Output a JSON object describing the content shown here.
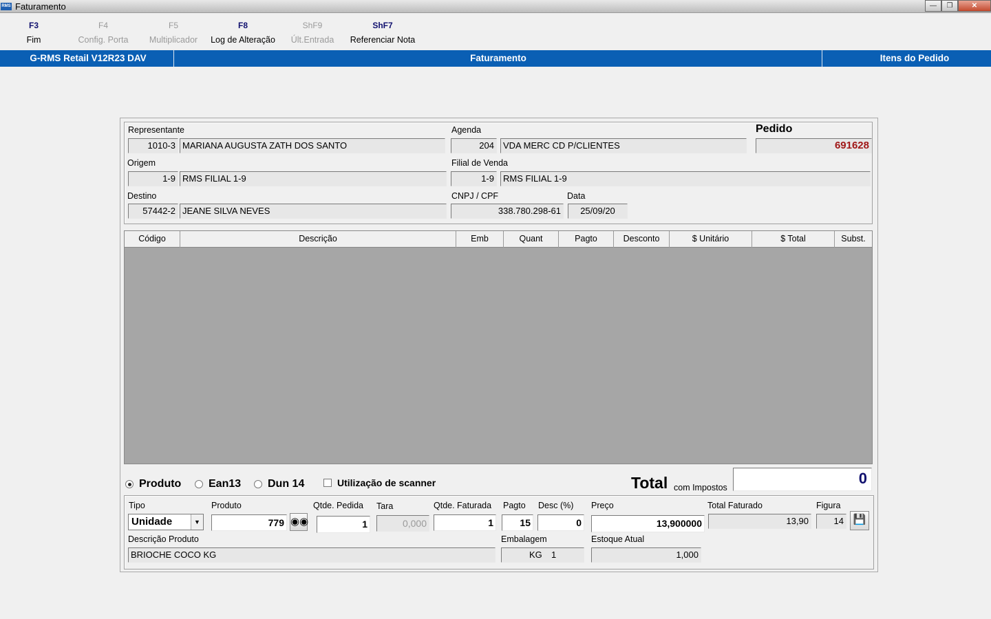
{
  "window": {
    "title": "Faturamento",
    "app_icon_text": "RMS"
  },
  "fkeys": [
    {
      "key": "F3",
      "label": "Fim",
      "enabled": true
    },
    {
      "key": "F4",
      "label": "Config. Porta",
      "enabled": false
    },
    {
      "key": "F5",
      "label": "Multiplicador",
      "enabled": false
    },
    {
      "key": "F8",
      "label": "Log de Alteração",
      "enabled": true
    },
    {
      "key": "ShF9",
      "label": "Últ.Entrada",
      "enabled": false
    },
    {
      "key": "ShF7",
      "label": "Referenciar Nota",
      "enabled": true
    }
  ],
  "band": {
    "system": "G-RMS Retail V12R23 DAV",
    "screen": "Faturamento",
    "section": "Itens do Pedido"
  },
  "header": {
    "representante": {
      "label": "Representante",
      "code": "1010-3",
      "name": "MARIANA AUGUSTA ZATH DOS SANTO"
    },
    "agenda": {
      "label": "Agenda",
      "code": "204",
      "name": "VDA MERC CD P/CLIENTES"
    },
    "pedido": {
      "label": "Pedido",
      "value": "691628"
    },
    "origem": {
      "label": "Origem",
      "code": "1-9",
      "name": "RMS FILIAL 1-9"
    },
    "filial": {
      "label": "Filial de Venda",
      "code": "1-9",
      "name": "RMS FILIAL 1-9"
    },
    "destino": {
      "label": "Destino",
      "code": "57442-2",
      "name": "JEANE SILVA NEVES"
    },
    "cnpj": {
      "label": "CNPJ / CPF",
      "value": "338.780.298-61"
    },
    "data": {
      "label": "Data",
      "value": "25/09/20"
    }
  },
  "grid": {
    "columns": [
      "Código",
      "Descrição",
      "Emb",
      "Quant",
      "Pagto",
      "Desconto",
      "$ Unitário",
      "$ Total",
      "Subst."
    ]
  },
  "mode": {
    "options": [
      "Produto",
      "Ean13",
      "Dun 14"
    ],
    "selected": "Produto",
    "scanner_label": "Utilização de scanner"
  },
  "total": {
    "title": "Total",
    "subtitle": "com Impostos",
    "value": "0"
  },
  "item": {
    "tipo": {
      "label": "Tipo",
      "value": "Unidade"
    },
    "produto": {
      "label": "Produto",
      "value": "779"
    },
    "qtde_pedida": {
      "label": "Qtde. Pedida",
      "value": "1"
    },
    "tara": {
      "label": "Tara",
      "value": "0,000"
    },
    "qtde_faturada": {
      "label": "Qtde. Faturada",
      "value": "1"
    },
    "pagto": {
      "label": "Pagto",
      "value": "15"
    },
    "desc": {
      "label": "Desc (%)",
      "value": "0"
    },
    "preco": {
      "label": "Preço",
      "value": "13,900000"
    },
    "total_faturado": {
      "label": "Total Faturado",
      "value": "13,90"
    },
    "figura": {
      "label": "Figura",
      "value": "14"
    },
    "descricao": {
      "label": "Descrição Produto",
      "value": "BRIOCHE COCO KG"
    },
    "embalagem": {
      "label": "Embalagem",
      "unit": "KG",
      "qty": "1"
    },
    "estoque": {
      "label": "Estoque Atual",
      "value": "1,000"
    }
  }
}
